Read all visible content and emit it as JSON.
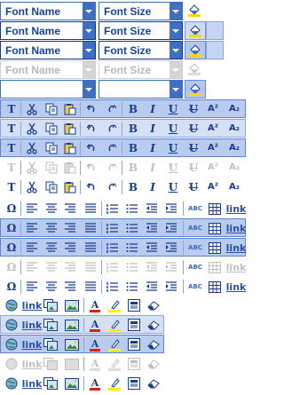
{
  "font_toolbar": {
    "font_name_label": "Font Name",
    "font_size_label": "Font Size",
    "paint_icon": "fill-color-icon",
    "states": [
      "normal",
      "hover",
      "pressed",
      "disabled",
      "empty"
    ]
  },
  "format_toolbar": {
    "icons": [
      "text-style-icon",
      "cut-icon",
      "copy-icon",
      "paste-icon",
      "undo-icon",
      "redo-icon",
      "bold-icon",
      "italic-icon",
      "underline-icon",
      "strikethrough-icon",
      "superscript-icon",
      "subscript-icon"
    ],
    "labels": {
      "text": "T",
      "bold": "B",
      "italic": "I",
      "underline": "U",
      "strike": "U",
      "sup": "A²",
      "sub": "A₂"
    },
    "states": [
      "pressed",
      "hover",
      "pressed",
      "disabled",
      "plain"
    ]
  },
  "paragraph_toolbar": {
    "icons": [
      "special-char-icon",
      "align-left-icon",
      "align-center-icon",
      "align-right-icon",
      "justify-icon",
      "numbered-list-icon",
      "bullet-list-icon",
      "outdent-icon",
      "indent-icon",
      "spellcheck-icon",
      "table-icon",
      "insert-link-icon"
    ],
    "labels": {
      "omega": "Ω",
      "spell": "ABC",
      "link": "link"
    },
    "states": [
      "plain",
      "pressed",
      "pressed",
      "disabled",
      "plain"
    ]
  },
  "insert_toolbar": {
    "icons": [
      "web-icon",
      "link-icon",
      "image-gallery-icon",
      "image-icon",
      "font-color-icon",
      "highlight-icon",
      "source-icon",
      "eraser-icon"
    ],
    "labels": {
      "link": "link",
      "font_color": "A"
    },
    "states": [
      "plain",
      "hover",
      "pressed",
      "disabled",
      "plain"
    ]
  }
}
